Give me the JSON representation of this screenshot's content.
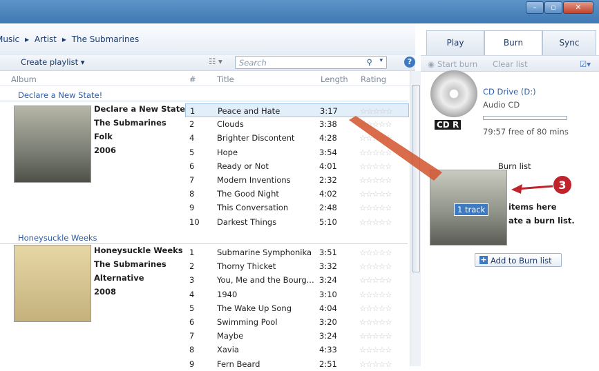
{
  "window": {
    "minimize_icon": "minimize-icon",
    "maximize_icon": "maximize-icon",
    "close_icon": "close-icon"
  },
  "breadcrumb": [
    "Music",
    "Artist",
    "The Submarines"
  ],
  "toolbar": {
    "create_playlist": "Create playlist",
    "search_placeholder": "Search"
  },
  "columns": {
    "album": "Album",
    "number": "#",
    "title": "Title",
    "length": "Length",
    "rating": "Rating"
  },
  "albums": [
    {
      "group": "Declare a New State!",
      "name": "Declare a New State!",
      "artist": "The Submarines",
      "genre": "Folk",
      "year": "2006",
      "tracks": [
        {
          "n": "1",
          "title": "Peace and Hate",
          "length": "3:17",
          "selected": true
        },
        {
          "n": "2",
          "title": "Clouds",
          "length": "3:38"
        },
        {
          "n": "4",
          "title": "Brighter Discontent",
          "length": "4:28"
        },
        {
          "n": "5",
          "title": "Hope",
          "length": "3:54"
        },
        {
          "n": "6",
          "title": "Ready or Not",
          "length": "4:01"
        },
        {
          "n": "7",
          "title": "Modern Inventions",
          "length": "2:32"
        },
        {
          "n": "8",
          "title": "The Good Night",
          "length": "4:02"
        },
        {
          "n": "9",
          "title": "This Conversation",
          "length": "2:48"
        },
        {
          "n": "10",
          "title": "Darkest Things",
          "length": "5:10"
        }
      ]
    },
    {
      "group": "Honeysuckle Weeks",
      "name": "Honeysuckle Weeks",
      "artist": "The Submarines",
      "genre": "Alternative",
      "year": "2008",
      "tracks": [
        {
          "n": "1",
          "title": "Submarine Symphonika",
          "length": "3:51"
        },
        {
          "n": "2",
          "title": "Thorny Thicket",
          "length": "3:32"
        },
        {
          "n": "3",
          "title": "You, Me and the Bourg...",
          "length": "3:24"
        },
        {
          "n": "4",
          "title": "1940",
          "length": "3:10"
        },
        {
          "n": "5",
          "title": "The Wake Up Song",
          "length": "4:04"
        },
        {
          "n": "6",
          "title": "Swimming Pool",
          "length": "3:20"
        },
        {
          "n": "7",
          "title": "Maybe",
          "length": "3:24"
        },
        {
          "n": "8",
          "title": "Xavia",
          "length": "4:33"
        },
        {
          "n": "9",
          "title": "Fern Beard",
          "length": "2:51"
        }
      ]
    }
  ],
  "tabs": [
    "Play",
    "Burn",
    "Sync"
  ],
  "active_tab": "Burn",
  "burn": {
    "start_burn": "Start burn",
    "clear_list": "Clear list",
    "drive": "CD Drive (D:)",
    "media": "Audio CD",
    "cd_label": "CD R",
    "free": "79:57 free of 80 mins",
    "list_title": "Burn list",
    "drag_badge": "1 track",
    "hint_line1": "items here",
    "hint_line2": "ate a burn list.",
    "add_button": "Add to Burn list"
  },
  "callout": "3",
  "colors": {
    "accent": "#2c5da8",
    "callout": "#c0232b",
    "titlebar": "#3f78b3"
  }
}
